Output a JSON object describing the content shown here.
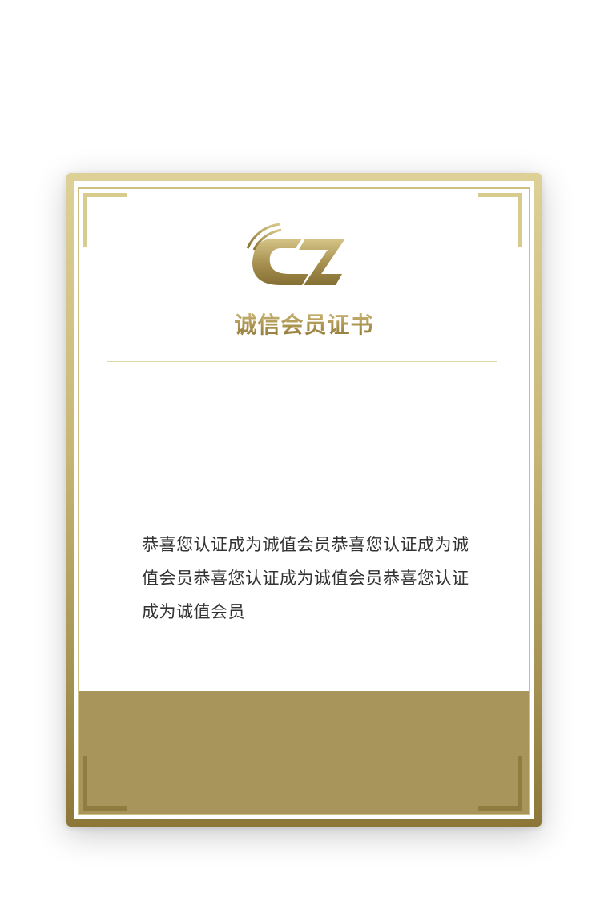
{
  "certificate": {
    "logo_text": "CZ",
    "title": "诚信会员证书",
    "message": "恭喜您认证成为诚值会员恭喜您认证成为诚值会员恭喜您认证成为诚值会员恭喜您认证成为诚值会员"
  },
  "colors": {
    "gold_light": "#ddd197",
    "gold_dark": "#8d7738",
    "band": "#a8955c",
    "text": "#333333"
  },
  "icons": [
    "cz-logo-icon"
  ]
}
